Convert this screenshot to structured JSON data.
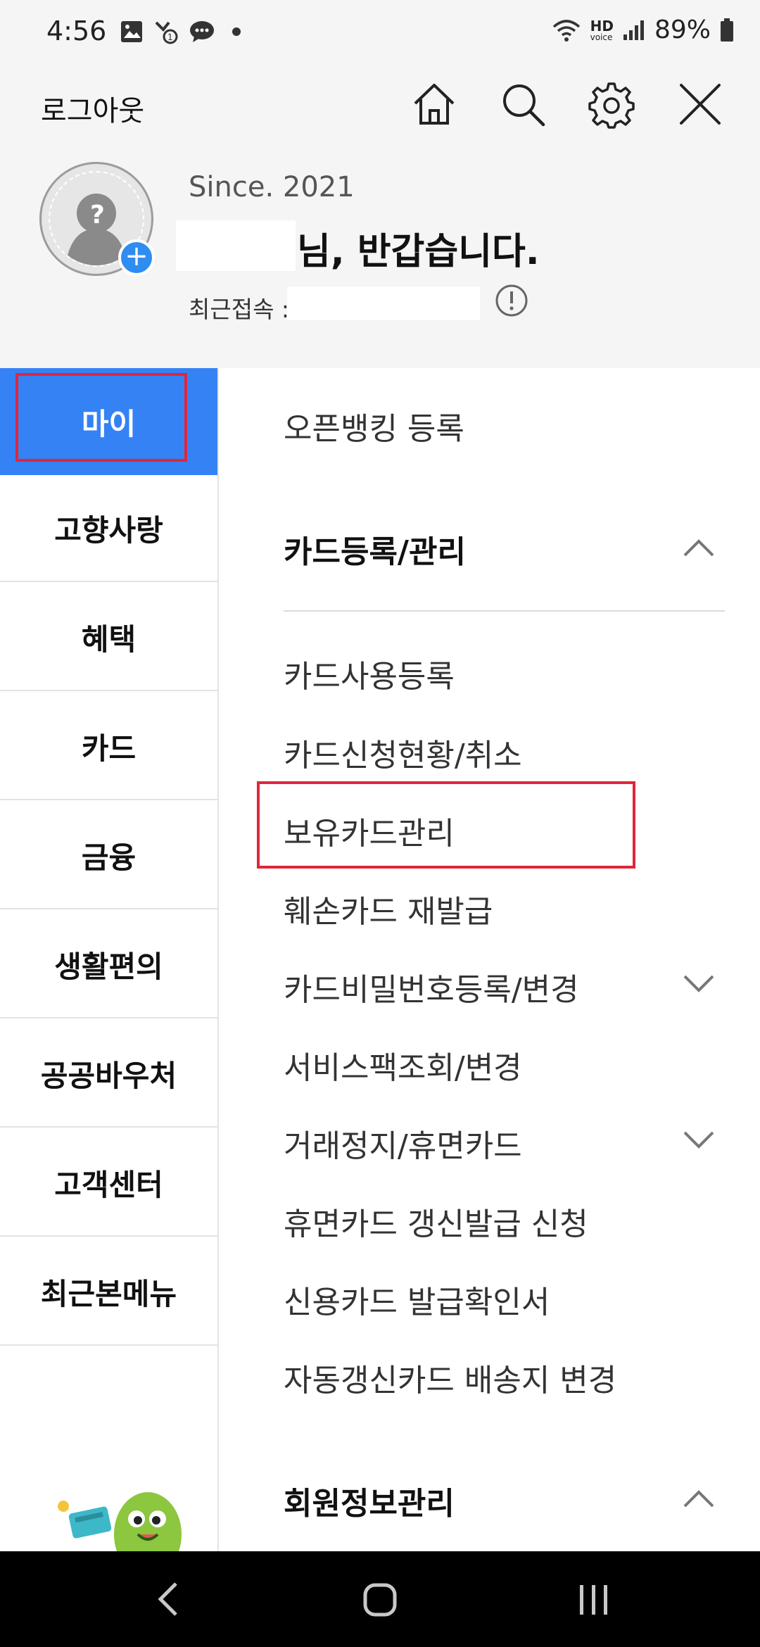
{
  "status_bar": {
    "time": "4:56",
    "battery_percent": "89%",
    "hd_label": "HD",
    "voice_label": "voice",
    "icons": [
      "gallery-icon",
      "missed-call-icon",
      "message-icon",
      "wifi-icon",
      "signal-icon",
      "battery-icon"
    ]
  },
  "header": {
    "logout_label": "로그아웃",
    "since_text": "Since. 2021",
    "greeting_text": "님, 반갑습니다.",
    "recent_login_label": "최근접속 :",
    "icons": [
      "home-icon",
      "search-icon",
      "gear-icon",
      "close-icon"
    ]
  },
  "left_nav": {
    "items": [
      {
        "label": "마이",
        "active": true
      },
      {
        "label": "고향사랑",
        "active": false
      },
      {
        "label": "혜택",
        "active": false
      },
      {
        "label": "카드",
        "active": false
      },
      {
        "label": "금융",
        "active": false
      },
      {
        "label": "생활편의",
        "active": false
      },
      {
        "label": "공공바우처",
        "active": false
      },
      {
        "label": "고객센터",
        "active": false
      },
      {
        "label": "최근본메뉴",
        "active": false
      }
    ]
  },
  "menu": {
    "open_banking": "오픈뱅킹 등록",
    "card_section_title": "카드등록/관리",
    "card_items": [
      "카드사용등록",
      "카드신청현황/취소",
      "보유카드관리",
      "훼손카드 재발급",
      "카드비밀번호등록/변경",
      "서비스팩조회/변경",
      "거래정지/휴면카드",
      "휴면카드 갱신발급 신청",
      "신용카드 발급확인서",
      "자동갱신카드 배송지 변경"
    ],
    "member_section_title": "회원정보관리"
  },
  "colors": {
    "accent": "#3582f5",
    "highlight_border": "#e0263a",
    "header_bg": "#f5f5f5",
    "plus_badge": "#2f8cf0"
  }
}
